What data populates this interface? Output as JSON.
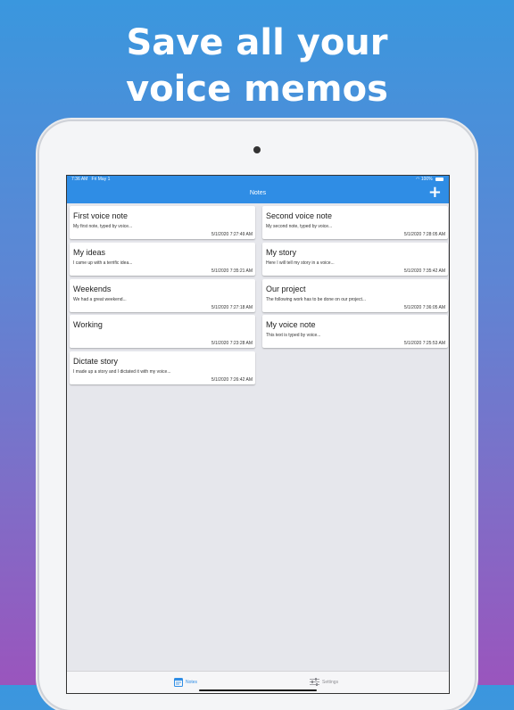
{
  "headline": {
    "line1": "Save all your",
    "line2": "voice memos"
  },
  "status": {
    "time": "7:36 AM",
    "date": "Fri May 1",
    "battery": "100%"
  },
  "nav": {
    "title": "Notes",
    "add": "+"
  },
  "notes": [
    {
      "title": "First voice note",
      "preview": "My first note, typed by voice...",
      "date": "5/1/2020 7:27:49 AM"
    },
    {
      "title": "Second voice note",
      "preview": "My second note, typed by voice...",
      "date": "5/1/2020 7:28:05 AM"
    },
    {
      "title": "My ideas",
      "preview": "I came up with a terrific idea...",
      "date": "5/1/2020 7:35:21 AM"
    },
    {
      "title": "My story",
      "preview": "Here I will tell my story in a voice...",
      "date": "5/1/2020 7:35:42 AM"
    },
    {
      "title": "Weekends",
      "preview": "We had a great weekend...",
      "date": "5/1/2020 7:27:18 AM"
    },
    {
      "title": "Our project",
      "preview": "The following work has to be done on our project...",
      "date": "5/1/2020 7:36:05 AM"
    },
    {
      "title": "Working",
      "preview": "",
      "date": "5/1/2020 7:23:28 AM"
    },
    {
      "title": "My voice note",
      "preview": "This text is typed by voice...",
      "date": "5/1/2020 7:25:53 AM"
    },
    {
      "title": "Dictate story",
      "preview": "I made up a story and I dictated it with my voice...",
      "date": "5/1/2020 7:26:42 AM"
    }
  ],
  "tabs": {
    "notes": "Notes",
    "settings": "Settings"
  },
  "colors": {
    "accent": "#2f8de5",
    "inactive": "#8e8e93"
  }
}
